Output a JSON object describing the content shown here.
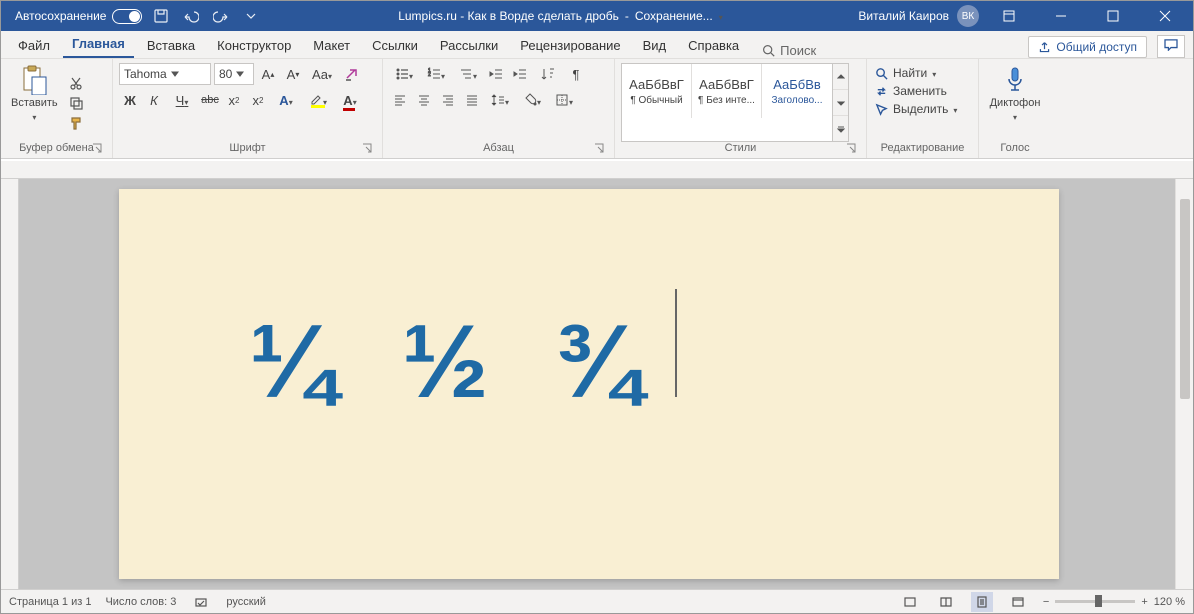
{
  "titlebar": {
    "autosave_label": "Автосохранение",
    "doc_title": "Lumpics.ru - Как в Ворде сделать дробь",
    "save_status": "Сохранение...",
    "user_name": "Виталий Каиров",
    "user_initials": "ВК"
  },
  "tabs": {
    "file": "Файл",
    "home": "Главная",
    "insert": "Вставка",
    "design": "Конструктор",
    "layout": "Макет",
    "references": "Ссылки",
    "mailings": "Рассылки",
    "review": "Рецензирование",
    "view": "Вид",
    "help": "Справка",
    "search_placeholder": "Поиск",
    "share": "Общий доступ"
  },
  "ribbon": {
    "clipboard": {
      "label": "Буфер обмена",
      "paste": "Вставить"
    },
    "font": {
      "label": "Шрифт",
      "name": "Tahoma",
      "size": "80",
      "bold": "Ж",
      "italic": "К",
      "underline": "Ч",
      "strike": "abc"
    },
    "paragraph": {
      "label": "Абзац"
    },
    "styles": {
      "label": "Стили",
      "preview": "АаБбВвГ",
      "preview_heading": "АаБбВв",
      "items": [
        "¶ Обычный",
        "¶ Без инте...",
        "Заголово..."
      ]
    },
    "editing": {
      "label": "Редактирование",
      "find": "Найти",
      "replace": "Заменить",
      "select": "Выделить"
    },
    "voice": {
      "label": "Голос",
      "dictate": "Диктофон"
    }
  },
  "document": {
    "fractions": [
      "¼",
      "½",
      "¾"
    ]
  },
  "status": {
    "page": "Страница 1 из 1",
    "words": "Число слов: 3",
    "language": "русский",
    "zoom": "120 %"
  }
}
